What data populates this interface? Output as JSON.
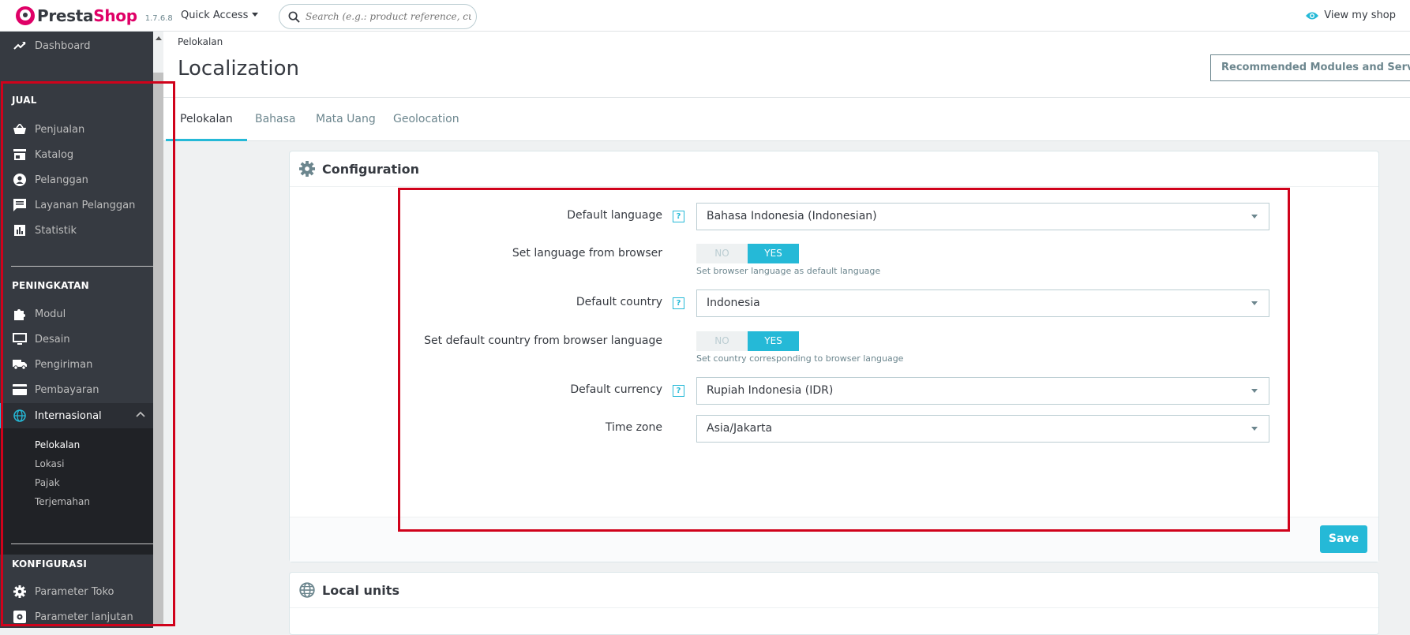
{
  "brand": {
    "logo_part1": "Presta",
    "logo_part2": "Shop",
    "version": "1.7.6.8"
  },
  "header": {
    "quick_access": "Quick Access",
    "search_placeholder": "Search (e.g.: product reference, customer name…)",
    "view_shop": "View my shop"
  },
  "sidebar": {
    "dashboard": "Dashboard",
    "sections": [
      {
        "title": "JUAL",
        "items": [
          "Penjualan",
          "Katalog",
          "Pelanggan",
          "Layanan Pelanggan",
          "Statistik"
        ]
      },
      {
        "title": "PENINGKATAN",
        "items": [
          "Modul",
          "Desain",
          "Pengiriman",
          "Pembayaran",
          "Internasional"
        ]
      },
      {
        "title": "KONFIGURASI",
        "items": [
          "Parameter Toko",
          "Parameter lanjutan"
        ]
      }
    ],
    "submenu": [
      "Pelokalan",
      "Lokasi",
      "Pajak",
      "Terjemahan"
    ]
  },
  "page": {
    "breadcrumb": "Pelokalan",
    "title": "Localization",
    "recommended_button": "Recommended Modules and Services"
  },
  "tabs": [
    "Pelokalan",
    "Bahasa",
    "Mata Uang",
    "Geolocation"
  ],
  "configuration": {
    "title": "Configuration",
    "default_language_label": "Default language",
    "default_language_value": "Bahasa Indonesia (Indonesian)",
    "set_language_label": "Set language from browser",
    "set_language_hint": "Set browser language as default language",
    "default_country_label": "Default country",
    "default_country_value": "Indonesia",
    "set_country_label": "Set default country from browser language",
    "set_country_hint": "Set country corresponding to browser language",
    "default_currency_label": "Default currency",
    "default_currency_value": "Rupiah Indonesia (IDR)",
    "timezone_label": "Time zone",
    "timezone_value": "Asia/Jakarta",
    "switch_no": "NO",
    "switch_yes": "YES",
    "help_glyph": "?",
    "save": "Save"
  },
  "local_units": {
    "title": "Local units"
  },
  "colors": {
    "accent": "#25b9d7",
    "sidebar": "#363a41",
    "brand": "#df0067",
    "highlight": "#d0021b"
  }
}
